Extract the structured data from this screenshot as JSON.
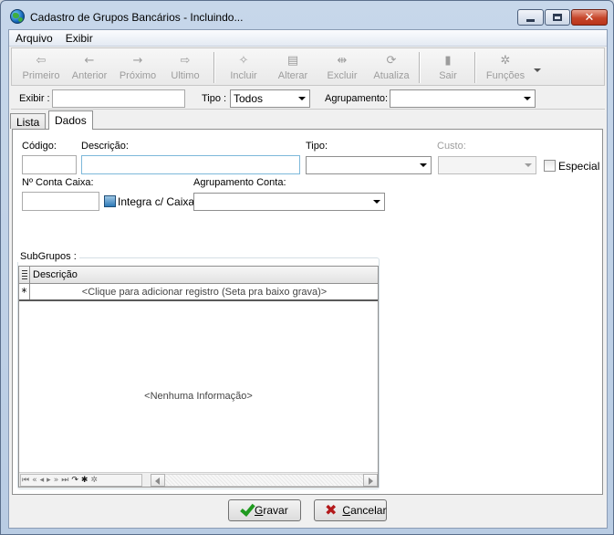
{
  "window": {
    "title": "Cadastro de Grupos Bancários - Incluindo...",
    "close_glyph": "✕"
  },
  "menu": {
    "items": [
      "Arquivo",
      "Exibir"
    ]
  },
  "toolbar": {
    "buttons": [
      {
        "label": "Primeiro",
        "icon": "first-record-icon",
        "glyph": "⇦",
        "enabled": false
      },
      {
        "label": "Anterior",
        "icon": "arrow-left-icon",
        "glyph": "←",
        "enabled": false
      },
      {
        "label": "Próximo",
        "icon": "arrow-right-icon",
        "glyph": "→",
        "enabled": false
      },
      {
        "label": "Ultimo",
        "icon": "last-record-icon",
        "glyph": "⇨",
        "enabled": false
      },
      {
        "label": "Incluir",
        "icon": "new-document-icon",
        "glyph": "✧",
        "enabled": false
      },
      {
        "label": "Alterar",
        "icon": "edit-document-icon",
        "glyph": "▤",
        "enabled": false
      },
      {
        "label": "Excluir",
        "icon": "delete-icon",
        "glyph": "⇹",
        "enabled": false
      },
      {
        "label": "Atualiza",
        "icon": "refresh-icon",
        "glyph": "⟳",
        "enabled": false
      },
      {
        "label": "Sair",
        "icon": "exit-door-icon",
        "glyph": "▮",
        "enabled": false
      },
      {
        "label": "Funções",
        "icon": "tools-icon",
        "glyph": "✲",
        "enabled": false
      }
    ]
  },
  "filter": {
    "exibir_label": "Exibir :",
    "exibir_value": "",
    "tipo_label": "Tipo :",
    "tipo_value": "Todos",
    "agrupamento_label": "Agrupamento:",
    "agrupamento_value": ""
  },
  "tabs": [
    {
      "label": "Lista",
      "active": false
    },
    {
      "label": "Dados",
      "active": true
    }
  ],
  "form": {
    "codigo_label": "Código:",
    "codigo_value": "",
    "descricao_label": "Descrição:",
    "descricao_value": "",
    "tipo_label": "Tipo:",
    "tipo_value": "",
    "custo_label": "Custo:",
    "custo_value": "",
    "especial_label": "Especial",
    "especial_checked": false,
    "conta_caixa_label": "Nº Conta Caixa:",
    "conta_caixa_value": "",
    "integra_label": "Integra c/ Caixa",
    "agrup_conta_label": "Agrupamento Conta:",
    "agrup_conta_value": ""
  },
  "subgrupos": {
    "title": "SubGrupos :",
    "columns": [
      "Descrição"
    ],
    "new_row_indicator": "*",
    "new_row_hint": "<Clique para adicionar registro (Seta pra baixo grava)>",
    "empty_text": "<Nenhuma Informação>",
    "nav_glyphs": [
      "⏮",
      "«",
      "◂",
      "▸",
      "»",
      "⏭",
      "↷",
      "✱",
      "✲"
    ]
  },
  "buttons": {
    "save_label_u": "G",
    "save_label_rest": "ravar",
    "cancel_label_u": "C",
    "cancel_label_rest": "ancelar",
    "cancel_glyph": "✖"
  },
  "colors": {
    "titlebar": "#c7d7ea",
    "close_button": "#c6452a",
    "save_check": "#1f9a1f",
    "cancel_x": "#b3191b"
  }
}
